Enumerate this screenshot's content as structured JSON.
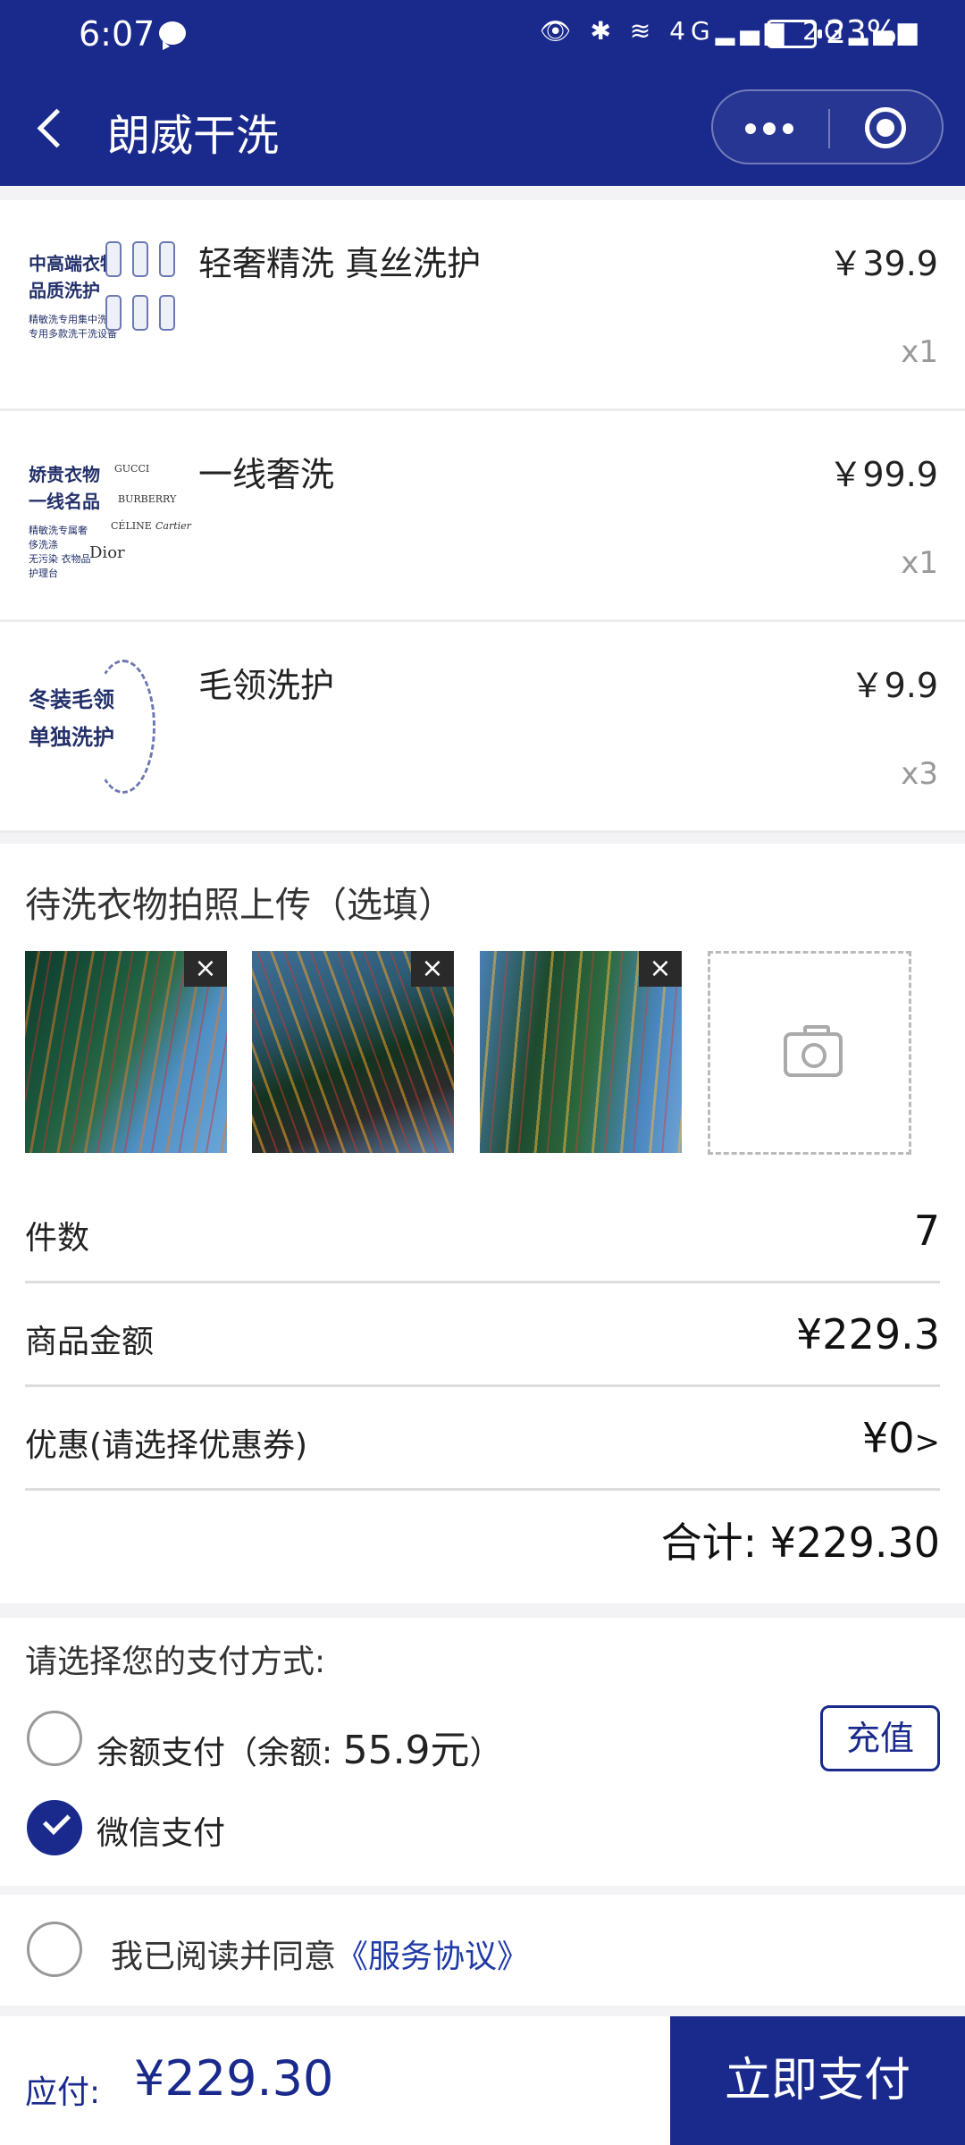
{
  "status_bar": {
    "time": "6:07",
    "signal_text": "👁 ✱ ≋ 4G▂▄▆ 2G▂▄▆",
    "battery": "23%"
  },
  "header": {
    "title": "朗威干洗"
  },
  "items": [
    {
      "name": "轻奢精洗 真丝洗护",
      "price": "￥39.9",
      "qty": "x1",
      "thumb_text": "中高端衣物\n品质洗护",
      "thumb_small": "精敏洗专用集中洗涤\n专用多款洗干洗设备"
    },
    {
      "name": "一线奢洗",
      "price": "￥99.9",
      "qty": "x1",
      "thumb_text": "娇贵衣物\n一线名品",
      "thumb_small": "精敏洗专属奢侈洗涤\n无污染 衣物品护理台"
    },
    {
      "name": "毛领洗护",
      "price": "￥9.9",
      "qty": "x3",
      "thumb_text": "冬装毛领\n单独洗护",
      "thumb_small": ""
    }
  ],
  "brands": [
    "GUCCI",
    "BURBERRY",
    "CÉLINE",
    "Cartier",
    "Dior"
  ],
  "upload": {
    "label": "待洗衣物拍照上传（选填）",
    "remove_glyph": "×"
  },
  "summary": {
    "count_label": "件数",
    "count_value": "7",
    "amount_label": "商品金额",
    "amount_value": "¥229.3",
    "discount_label": "优惠(请选择优惠券)",
    "discount_value": "¥0",
    "discount_arrow": ">",
    "total_label": "合计:",
    "total_value": "¥229.30"
  },
  "payment": {
    "label": "请选择您的支付方式:",
    "balance_option": "余额支付（余额: ",
    "balance_amount": "55.9元",
    "balance_close": "）",
    "recharge": "充值",
    "wechat_option": "微信支付"
  },
  "agreement": {
    "text": "我已阅读并同意",
    "link": "《服务协议》"
  },
  "footer": {
    "due_label": "应付:",
    "due_value": "¥229.30",
    "pay_button": "立即支付"
  },
  "colors": {
    "brand": "#1a2a8c",
    "link": "#1f3aa6"
  }
}
